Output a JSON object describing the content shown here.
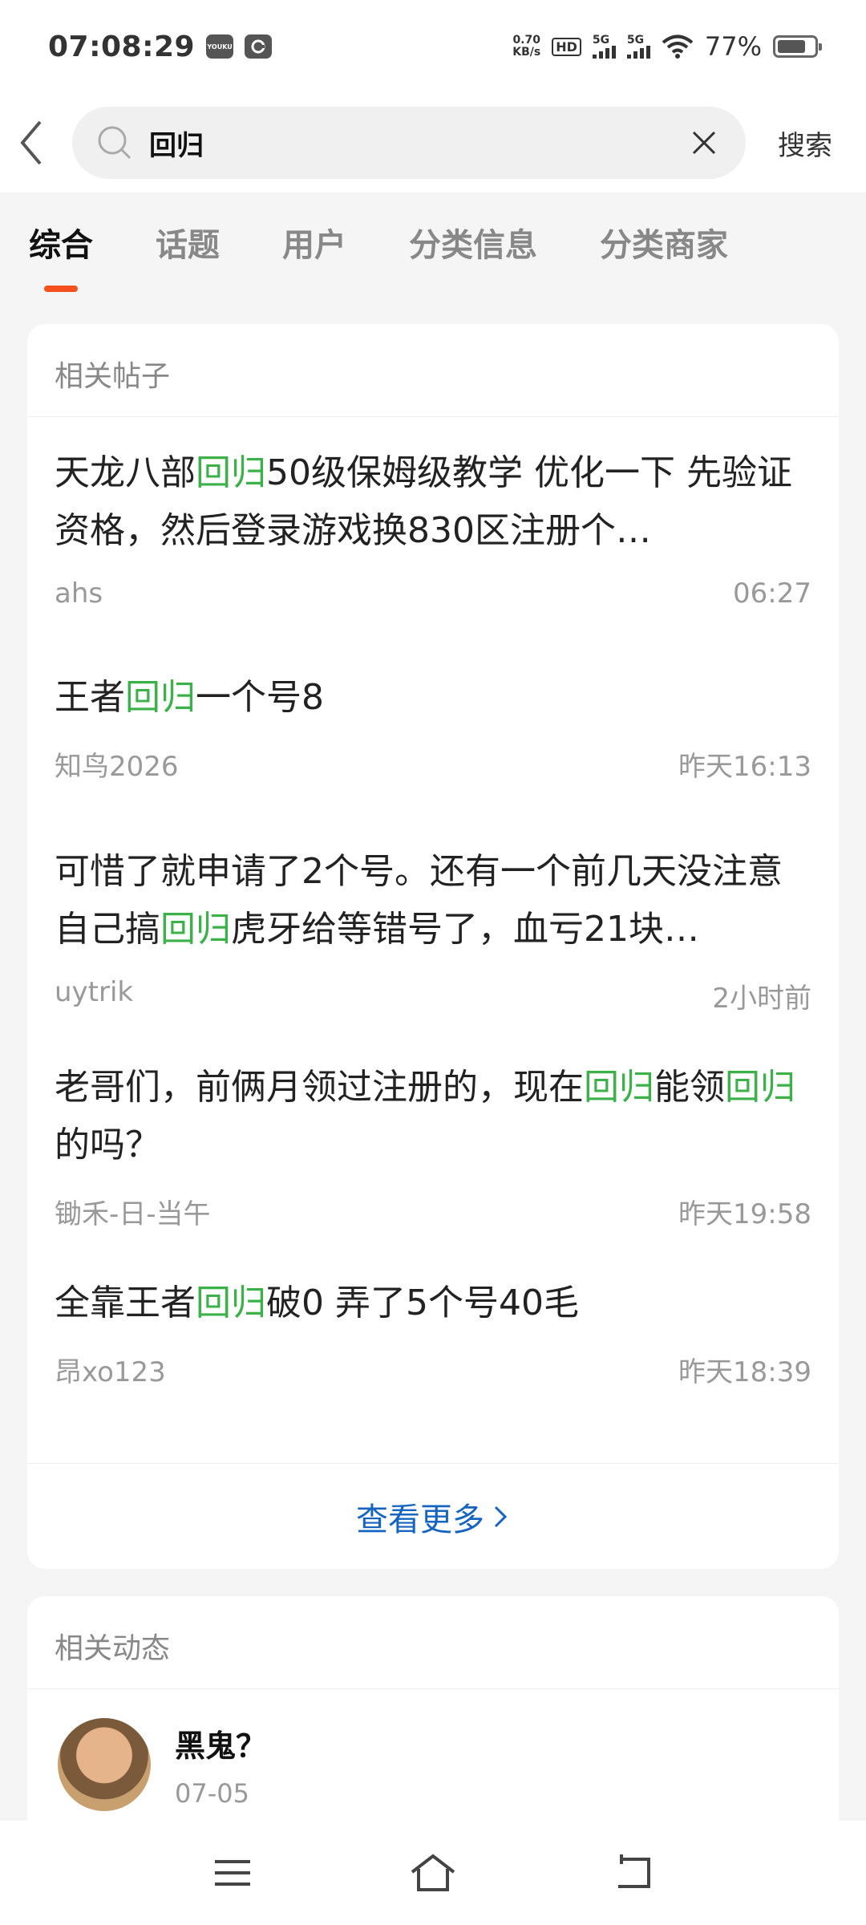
{
  "status_bar": {
    "time": "07:08:29",
    "app_icon_1": "YOUKU",
    "net_speed_value": "0.70",
    "net_speed_unit": "KB/s",
    "hd_badge": "HD",
    "signal_1_label": "5G",
    "signal_2_label": "5G",
    "battery_percent": "77%",
    "battery_level": 0.77
  },
  "search": {
    "query": "回归",
    "submit_label": "搜索"
  },
  "tabs": [
    {
      "label": "综合",
      "active": true
    },
    {
      "label": "话题",
      "active": false
    },
    {
      "label": "用户",
      "active": false
    },
    {
      "label": "分类信息",
      "active": false
    },
    {
      "label": "分类商家",
      "active": false
    }
  ],
  "posts_section": {
    "title": "相关帖子",
    "more_label": "查看更多",
    "posts": [
      {
        "before": "天龙八部",
        "highlight": "回归",
        "after": "50级保姆级教学 优化一下 先验证资格，然后登录游戏换830区注册个…",
        "author": "ahs",
        "time": "06:27"
      },
      {
        "before": "王者",
        "highlight": "回归",
        "after": "一个号8",
        "author": "知鸟2026",
        "time": "昨天16:13"
      },
      {
        "before": "可惜了就申请了2个号。还有一个前几天没注意自己搞",
        "highlight": "回归",
        "after": "虎牙给等错号了，血亏21块…",
        "author": "uytrik",
        "time": "2小时前"
      },
      {
        "before": "老哥们，前俩月领过注册的，现在",
        "highlight": "回归",
        "middle": "能领",
        "highlight2": "回归",
        "after": "的吗？",
        "author": "锄禾-日-当午",
        "time": "昨天19:58"
      },
      {
        "before": "全靠王者",
        "highlight": "回归",
        "after": "破0 弄了5个号40毛",
        "author": "昂xo123",
        "time": "昨天18:39"
      }
    ]
  },
  "dynamics_section": {
    "title": "相关动态",
    "user_name": "黑鬼？",
    "date": "07-05"
  },
  "colors": {
    "highlight": "#3cb14a",
    "tab_indicator": "#f4511e",
    "link": "#1565c0"
  }
}
